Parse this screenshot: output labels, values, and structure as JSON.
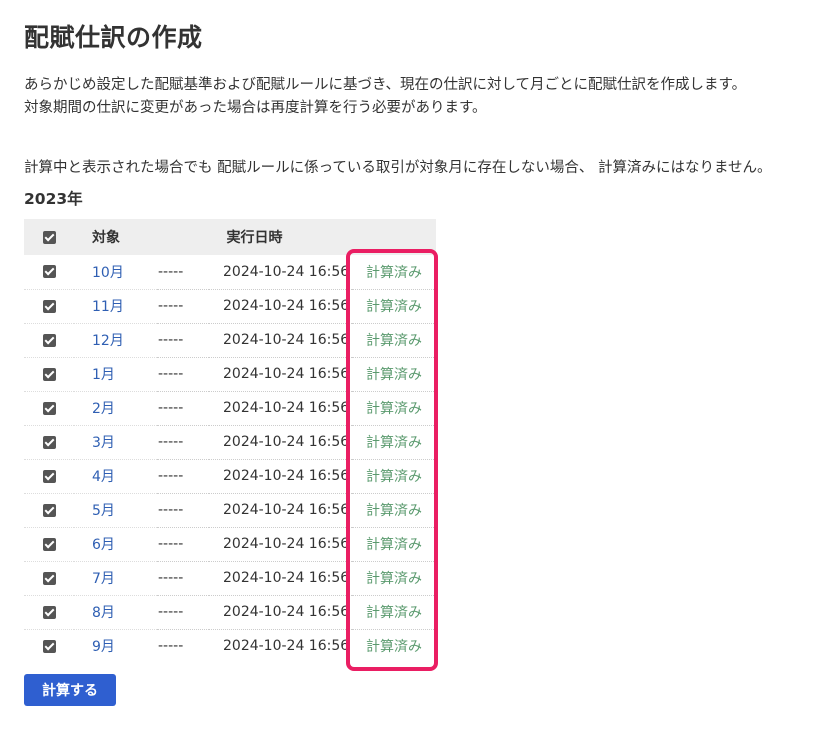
{
  "page": {
    "title": "配賦仕訳の作成",
    "description_line1": "あらかじめ設定した配賦基準および配賦ルールに基づき、現在の仕訳に対して月ごとに配賦仕訳を作成します。",
    "description_line2": "対象期間の仕訳に変更があった場合は再度計算を行う必要があります。",
    "note": "計算中と表示された場合でも 配賦ルールに係っている取引が対象月に存在しない場合、 計算済みにはなりません。",
    "year": "2023年"
  },
  "table": {
    "headers": {
      "target": "対象",
      "executed_at": "実行日時"
    },
    "header_checkbox_checked": true,
    "rows": [
      {
        "month": "10月",
        "dash": "-----",
        "datetime": "2024-10-24 16:56",
        "status": "計算済み",
        "checked": true
      },
      {
        "month": "11月",
        "dash": "-----",
        "datetime": "2024-10-24 16:56",
        "status": "計算済み",
        "checked": true
      },
      {
        "month": "12月",
        "dash": "-----",
        "datetime": "2024-10-24 16:56",
        "status": "計算済み",
        "checked": true
      },
      {
        "month": "1月",
        "dash": "-----",
        "datetime": "2024-10-24 16:56",
        "status": "計算済み",
        "checked": true
      },
      {
        "month": "2月",
        "dash": "-----",
        "datetime": "2024-10-24 16:56",
        "status": "計算済み",
        "checked": true
      },
      {
        "month": "3月",
        "dash": "-----",
        "datetime": "2024-10-24 16:56",
        "status": "計算済み",
        "checked": true
      },
      {
        "month": "4月",
        "dash": "-----",
        "datetime": "2024-10-24 16:56",
        "status": "計算済み",
        "checked": true
      },
      {
        "month": "5月",
        "dash": "-----",
        "datetime": "2024-10-24 16:56",
        "status": "計算済み",
        "checked": true
      },
      {
        "month": "6月",
        "dash": "-----",
        "datetime": "2024-10-24 16:56",
        "status": "計算済み",
        "checked": true
      },
      {
        "month": "7月",
        "dash": "-----",
        "datetime": "2024-10-24 16:56",
        "status": "計算済み",
        "checked": true
      },
      {
        "month": "8月",
        "dash": "-----",
        "datetime": "2024-10-24 16:56",
        "status": "計算済み",
        "checked": true
      },
      {
        "month": "9月",
        "dash": "-----",
        "datetime": "2024-10-24 16:56",
        "status": "計算済み",
        "checked": true
      }
    ]
  },
  "actions": {
    "calculate_label": "計算する"
  },
  "colors": {
    "link": "#2f5fb3",
    "status": "#5a9a6e",
    "highlight": "#ea1e63",
    "button": "#2f5fd0"
  }
}
